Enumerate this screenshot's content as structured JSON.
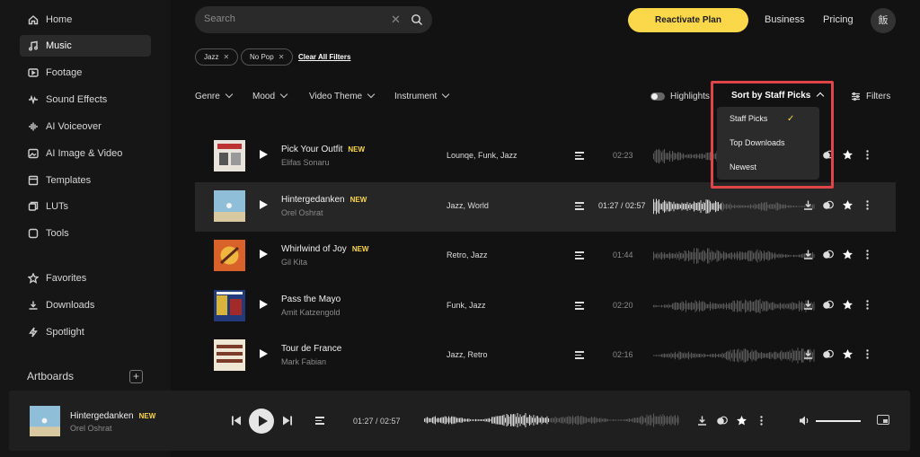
{
  "sidebar": {
    "items": [
      {
        "label": "Home",
        "icon": "home-icon"
      },
      {
        "label": "Music",
        "icon": "music-note-icon",
        "active": true
      },
      {
        "label": "Footage",
        "icon": "play-square-icon"
      },
      {
        "label": "Sound Effects",
        "icon": "waveform-icon"
      },
      {
        "label": "AI Voiceover",
        "icon": "audio-bars-icon"
      },
      {
        "label": "AI Image & Video",
        "icon": "image-icon"
      },
      {
        "label": "Templates",
        "icon": "templates-icon"
      },
      {
        "label": "LUTs",
        "icon": "luts-icon"
      },
      {
        "label": "Tools",
        "icon": "tools-icon"
      },
      {
        "label": "Favorites",
        "icon": "star-icon"
      },
      {
        "label": "Downloads",
        "icon": "download-icon"
      },
      {
        "label": "Spotlight",
        "icon": "bolt-icon"
      }
    ],
    "artboards_label": "Artboards",
    "add_label": "+"
  },
  "header": {
    "search_placeholder": "Search",
    "reactivate_label": "Reactivate Plan",
    "business_label": "Business",
    "pricing_label": "Pricing",
    "avatar_text": "飯"
  },
  "chips": [
    {
      "label": "Jazz"
    },
    {
      "label": "No Pop"
    }
  ],
  "clear_all_label": "Clear All Filters",
  "filters": {
    "genre": "Genre",
    "mood": "Mood",
    "video_theme": "Video Theme",
    "instrument": "Instrument",
    "highlights": "Highlights",
    "sort_label": "Sort by Staff Picks",
    "filters_label": "Filters"
  },
  "sort_dropdown": {
    "options": [
      "Staff Picks",
      "Top Downloads",
      "Newest"
    ],
    "selected": "Staff Picks"
  },
  "tracks": [
    {
      "title": "Pick Your Outfit",
      "badge": "NEW",
      "artist": "Elifas Sonaru",
      "genres": "Lounqe, Funk, Jazz",
      "duration": "02:23"
    },
    {
      "title": "Hintergedanken",
      "badge": "NEW",
      "artist": "Orel Oshrat",
      "genres": "Jazz, World",
      "duration": "01:27 / 02:57",
      "active": true
    },
    {
      "title": "Whirlwind of Joy",
      "badge": "NEW",
      "artist": "Gil Kita",
      "genres": "Retro, Jazz",
      "duration": "01:44"
    },
    {
      "title": "Pass the Mayo",
      "badge": "",
      "artist": "Amit Katzengold",
      "genres": "Funk, Jazz",
      "duration": "02:20"
    },
    {
      "title": "Tour de France",
      "badge": "",
      "artist": "Mark Fabian",
      "genres": "Jazz, Retro",
      "duration": "02:16"
    }
  ],
  "player": {
    "title": "Hintergedanken",
    "badge": "NEW",
    "artist": "Orel Oshrat",
    "time": "01:27 / 02:57",
    "progress": 0.49,
    "volume": 1.0
  },
  "colors": {
    "accent": "#fbd84a",
    "highlight_border": "#e0454a",
    "background": "#121212"
  }
}
